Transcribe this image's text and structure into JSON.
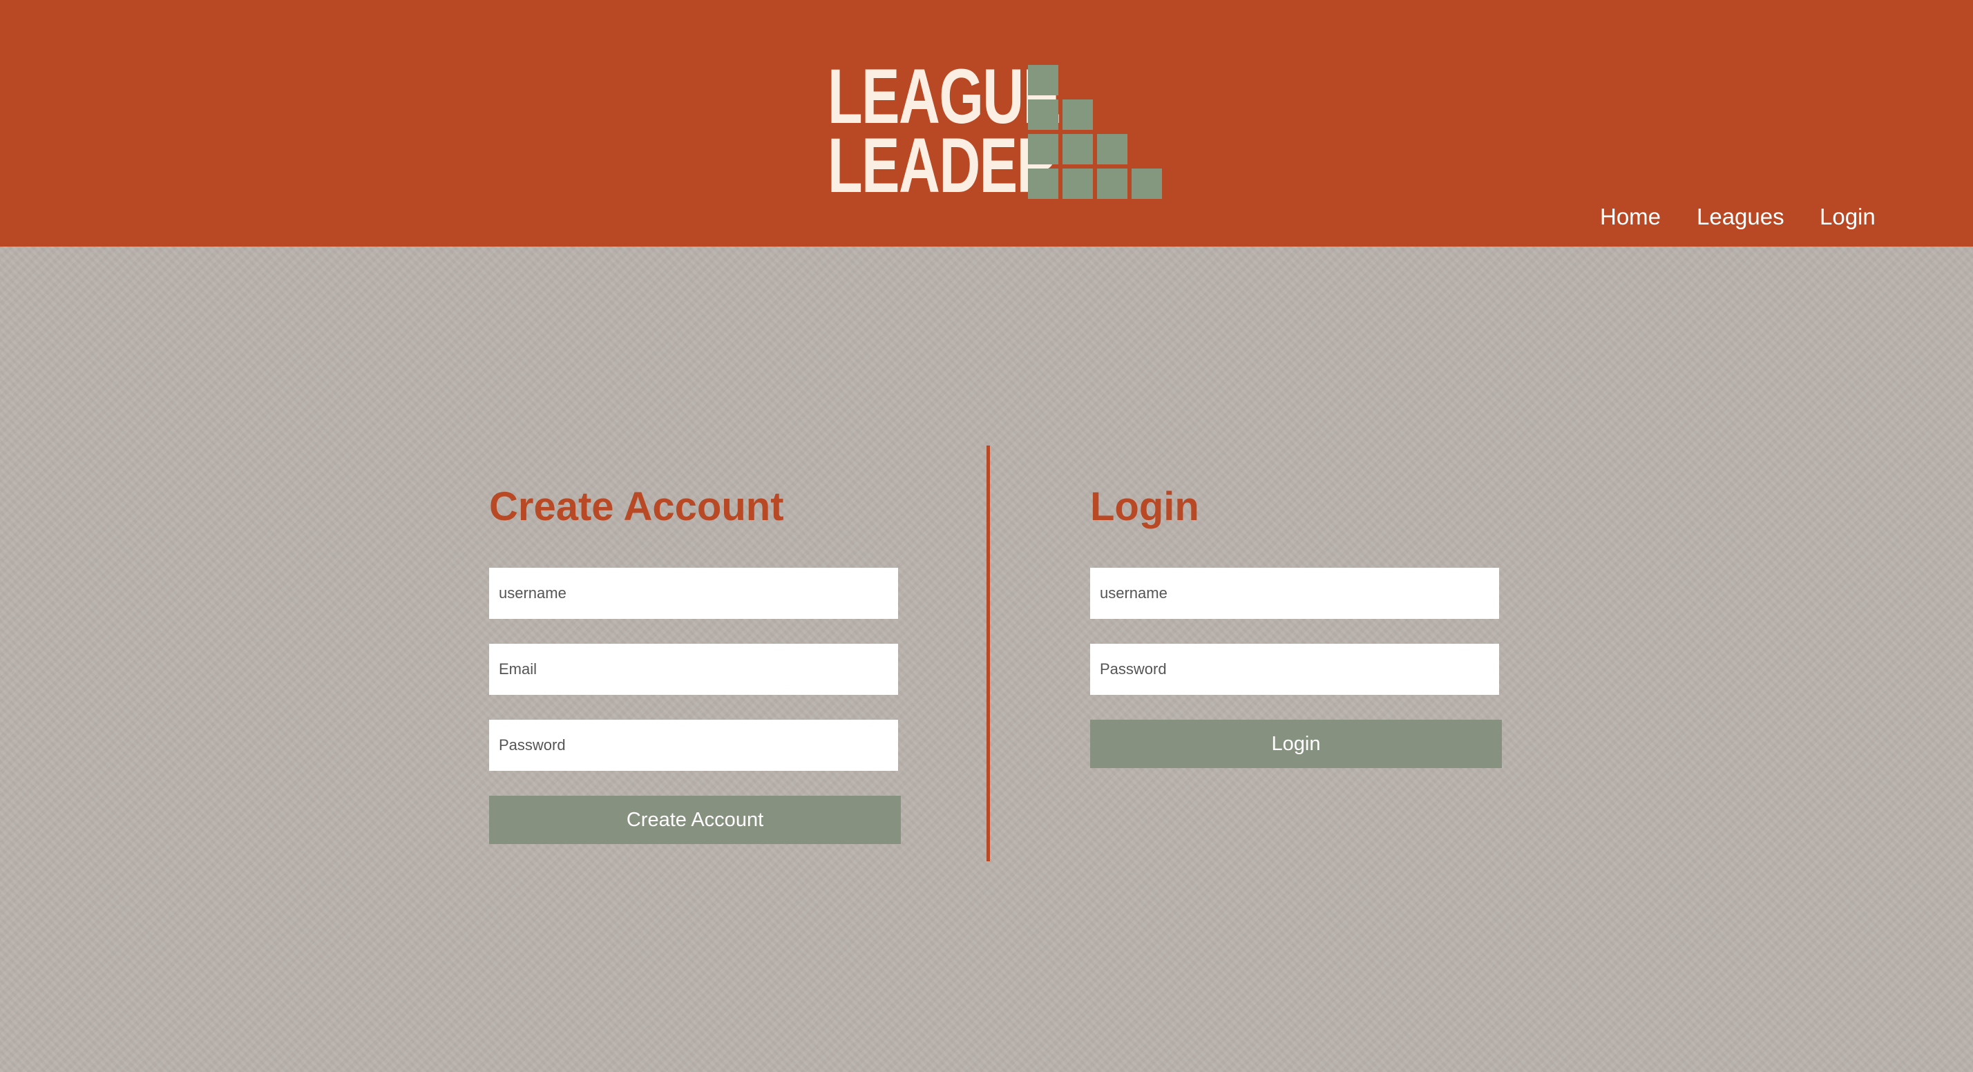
{
  "colors": {
    "header_bg": "#b84924",
    "page_bg": "#b9b1ab",
    "accent": "#b84924",
    "button_bg": "#879180",
    "logo_text": "#fbeee2",
    "logo_bars": "#84977f"
  },
  "logo": {
    "line1": "LEAGUE",
    "line2": "LEADER",
    "icon": "staircase-bars-icon"
  },
  "nav": {
    "items": [
      {
        "label": "Home"
      },
      {
        "label": "Leagues"
      },
      {
        "label": "Login"
      }
    ]
  },
  "create_account": {
    "title": "Create Account",
    "username_placeholder": "username",
    "email_placeholder": "Email",
    "password_placeholder": "Password",
    "submit_label": "Create Account"
  },
  "login": {
    "title": "Login",
    "username_placeholder": "username",
    "password_placeholder": "Password",
    "submit_label": "Login"
  }
}
